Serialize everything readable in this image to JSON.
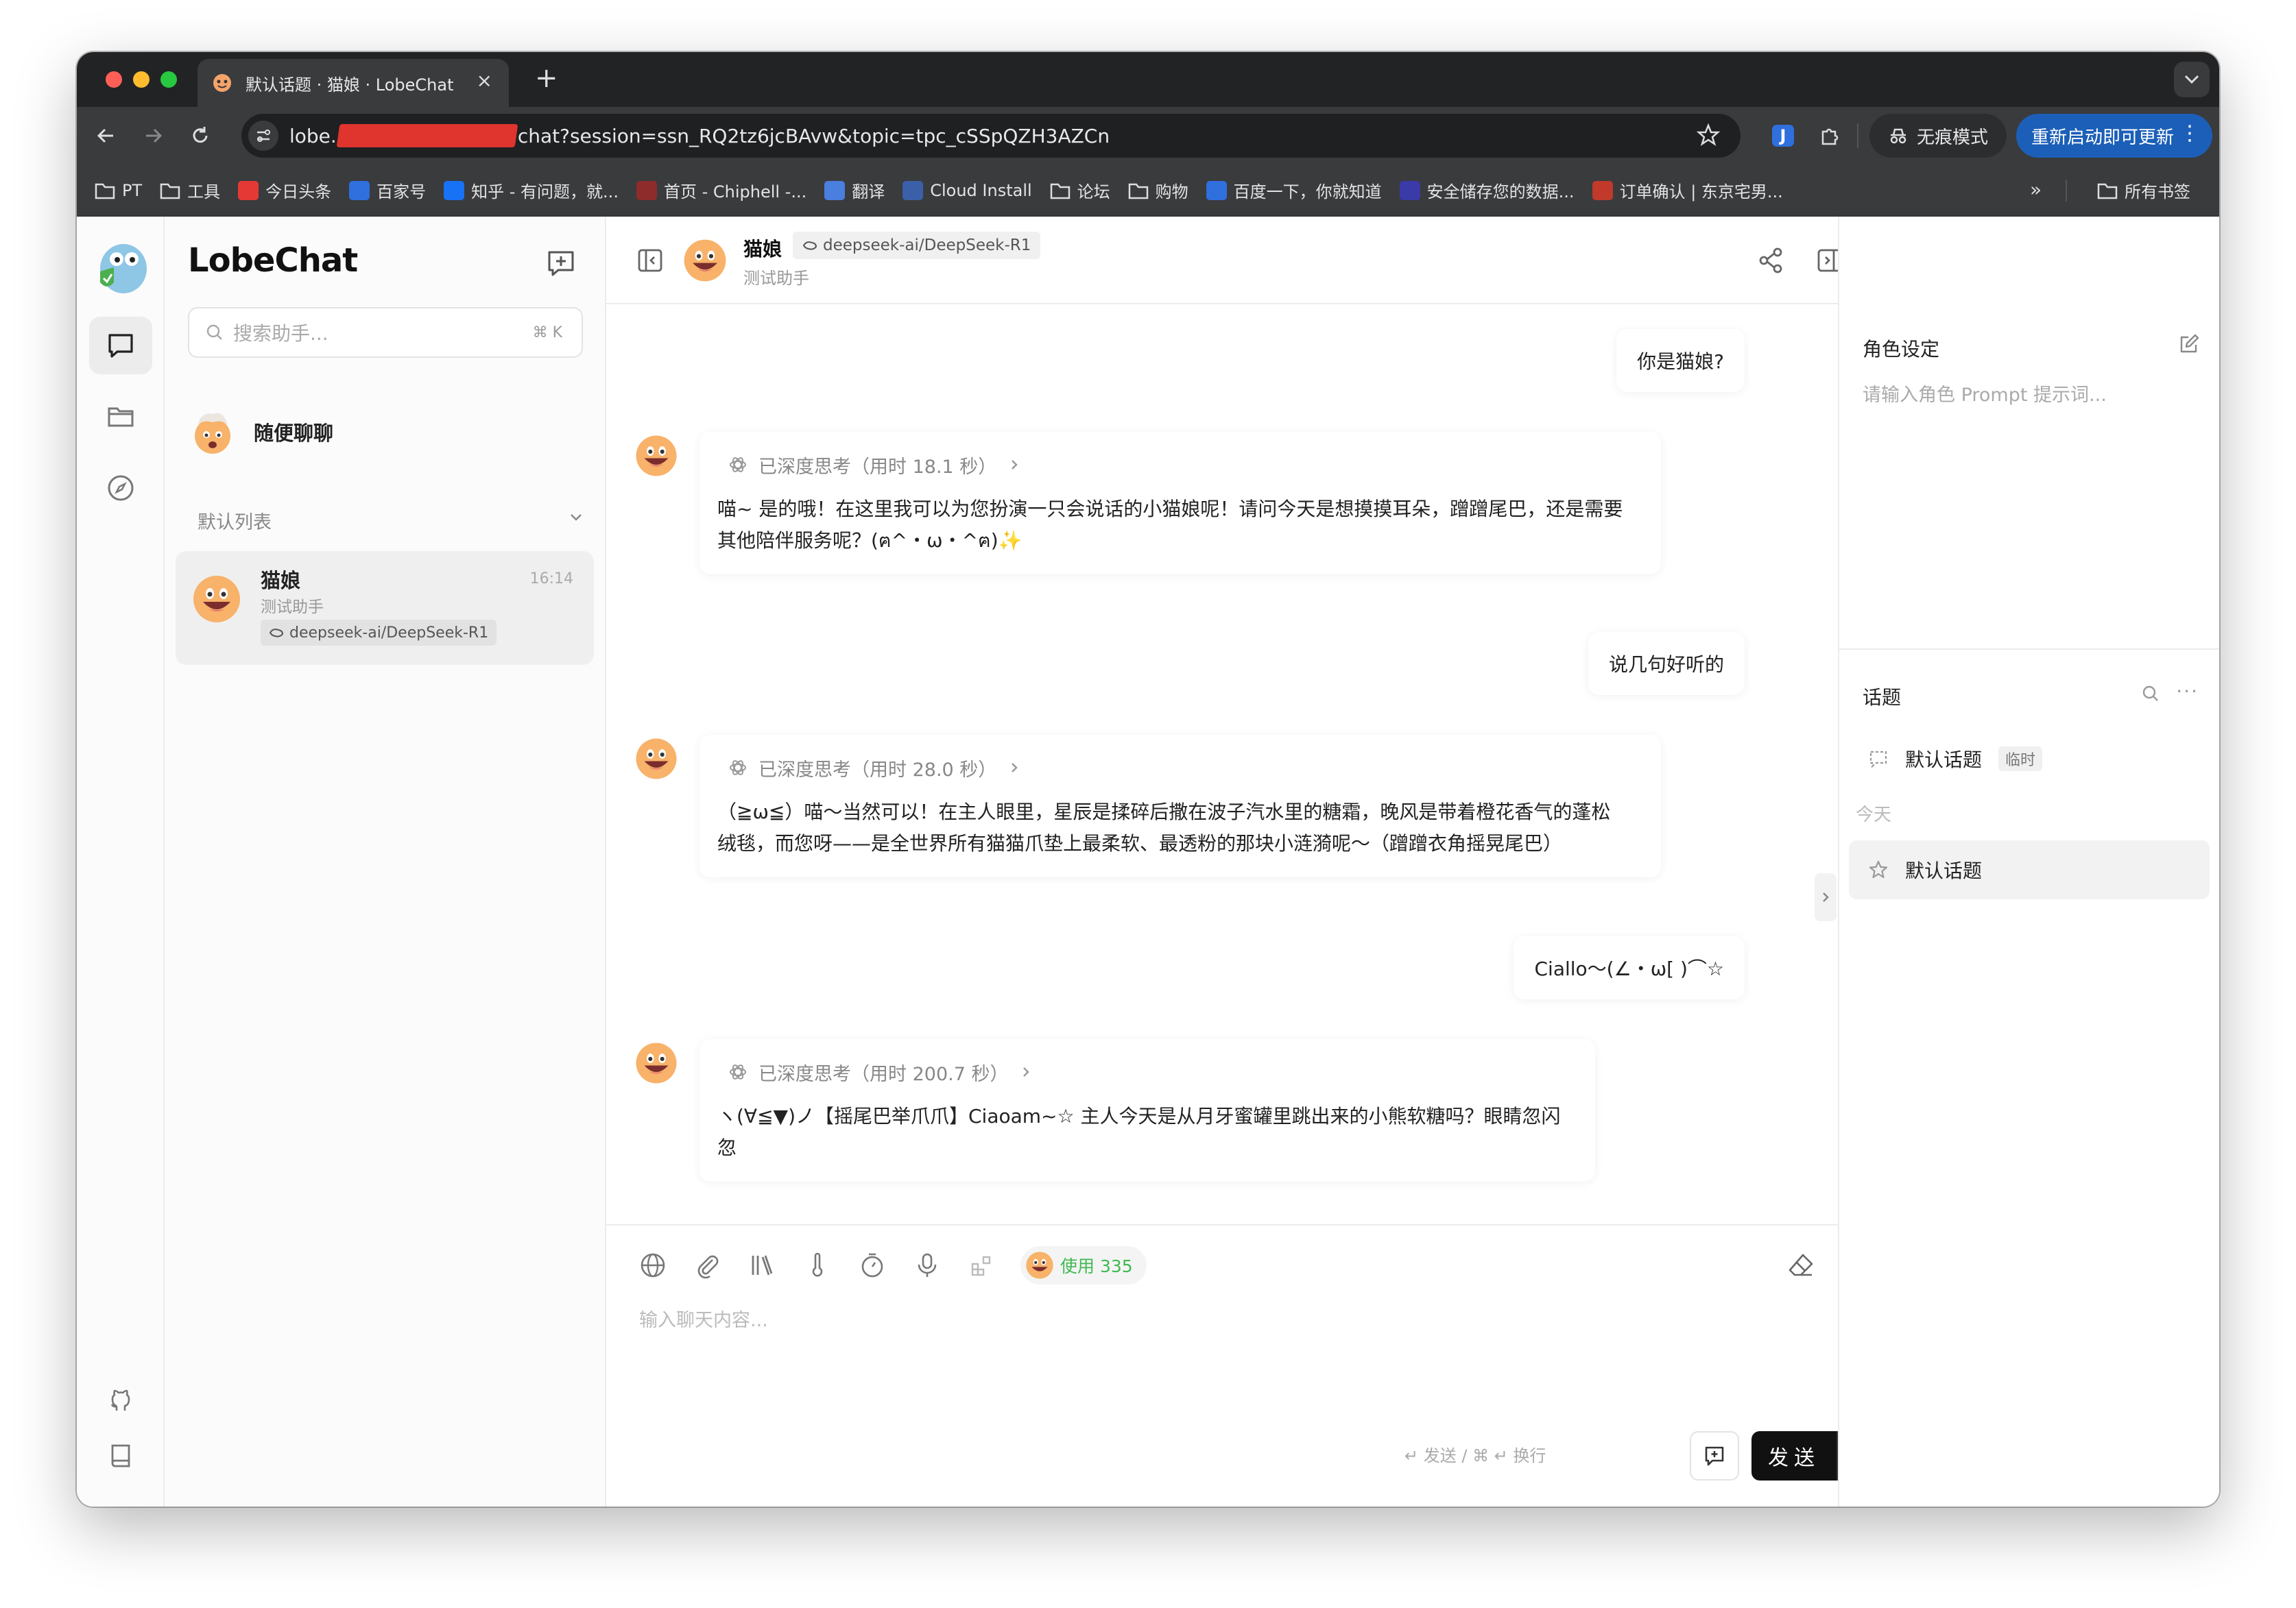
{
  "browser": {
    "tab_title": "默认话题 · 猫娘 · LobeChat",
    "url_prefix": "lobe.",
    "url_suffix": "chat?session=ssn_RQ2tz6jcBAvw&topic=tpc_cSSpQZH3AZCn",
    "incognito_label": "无痕模式",
    "relaunch_label": "重新启动即可更新",
    "bookmarks": [
      {
        "label": "PT",
        "icon": "folder-icon"
      },
      {
        "label": "工具",
        "icon": "folder-icon"
      },
      {
        "label": "今日头条",
        "icon": "toutiao-icon",
        "color": "#e53935"
      },
      {
        "label": "百家号",
        "icon": "baijiahao-icon",
        "color": "#2f6fde"
      },
      {
        "label": "知乎 - 有问题，就...",
        "icon": "zhihu-icon",
        "color": "#1772f6"
      },
      {
        "label": "首页 - Chiphell -...",
        "icon": "chiphell-icon",
        "color": "#8e2b2b"
      },
      {
        "label": "翻译",
        "icon": "translate-icon",
        "color": "#4a7fe0"
      },
      {
        "label": "Cloud Install",
        "icon": "cloud-icon",
        "color": "#3b5fa8"
      },
      {
        "label": "论坛",
        "icon": "folder-icon"
      },
      {
        "label": "购物",
        "icon": "folder-icon"
      },
      {
        "label": "百度一下，你就知道",
        "icon": "baidu-icon",
        "color": "#2f6fde"
      },
      {
        "label": "安全储存您的数据...",
        "icon": "storage-icon",
        "color": "#3a3aa8"
      },
      {
        "label": "订单确认 | 东京宅男...",
        "icon": "shop-icon",
        "color": "#c0392b"
      }
    ],
    "all_bookmarks_label": "所有书签"
  },
  "sessions": {
    "brand": "LobeChat",
    "search_placeholder": "搜索助手...",
    "search_shortcut": "⌘ K",
    "inbox_label": "随便聊聊",
    "group_label": "默认列表",
    "items": [
      {
        "title": "猫娘",
        "desc": "测试助手",
        "time": "16:14",
        "model": "deepseek-ai/DeepSeek-R1"
      }
    ]
  },
  "chat": {
    "agent_name": "猫娘",
    "agent_desc": "测试助手",
    "model": "deepseek-ai/DeepSeek-R1",
    "messages": [
      {
        "role": "user",
        "text": "你是猫娘?"
      },
      {
        "role": "assistant",
        "thinking": "已深度思考（用时 18.1 秒）",
        "lines": [
          "喵~ 是的哦！在这里我可以为您扮演一只会说话的小猫娘呢！请问今天是想摸摸耳朵，蹭蹭尾巴，还是需要",
          "其他陪伴服务呢？(ฅ^・ω・^ฅ)✨"
        ]
      },
      {
        "role": "user",
        "text": "说几句好听的"
      },
      {
        "role": "assistant",
        "thinking": "已深度思考（用时 28.0 秒）",
        "lines": [
          "（≧ω≦）喵～当然可以！在主人眼里，星辰是揉碎后撒在波子汽水里的糖霜，晚风是带着橙花香气的蓬松",
          "绒毯，而您呀——是全世界所有猫猫爪垫上最柔软、最透粉的那块小涟漪呢～（蹭蹭衣角摇晃尾巴）"
        ]
      },
      {
        "role": "user",
        "text": "Ciallo～(∠・ω[ )⌒☆"
      },
      {
        "role": "assistant",
        "thinking": "已深度思考（用时 200.7 秒）",
        "lines": [
          "ヽ(∀≦▼)ノ【摇尾巴举爪爪】Ciaoam~☆ 主人今天是从月牙蜜罐里跳出来的小熊软糖吗？眼睛忽闪忽"
        ]
      }
    ],
    "usage_label": "使用 335",
    "input_placeholder": "输入聊天内容...",
    "send_hint": "↵ 发送 / ⌘ ↵ 换行",
    "send_label": "发送"
  },
  "right_panel": {
    "role_title": "角色设定",
    "role_placeholder": "请输入角色 Prompt 提示词...",
    "topics_title": "话题",
    "default_topic": "默认话题",
    "temp_tag": "临时",
    "today_label": "今天",
    "today_topic": "默认话题"
  },
  "colors": {
    "accent_usage": "#3fb950",
    "relaunch_blue": "#1b5fb8",
    "chrome_dark": "#3a3b3d"
  }
}
